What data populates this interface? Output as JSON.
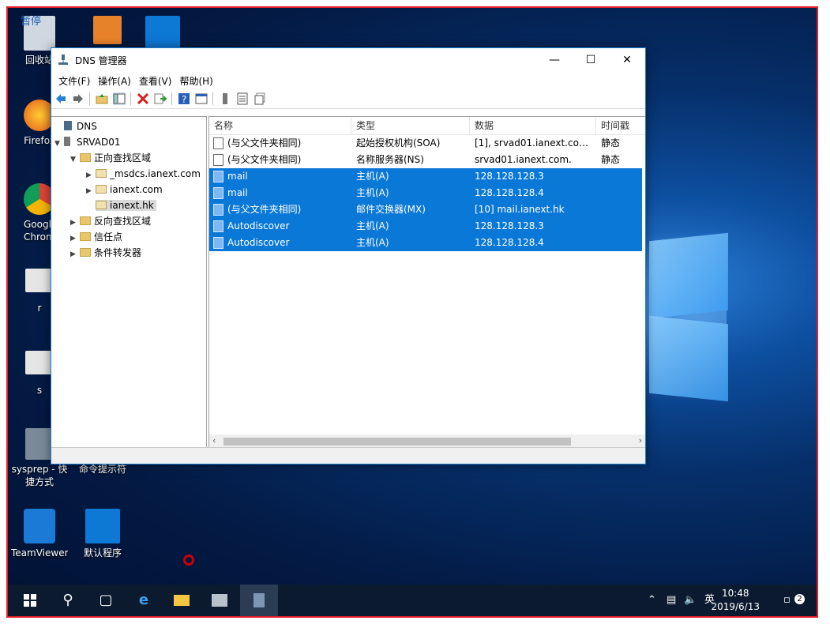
{
  "desktop": {
    "icons": [
      {
        "label": "回收站",
        "name": "recycle-bin"
      },
      {
        "label": "Firefox",
        "name": "firefox"
      },
      {
        "label": "Google Chrome",
        "name": "chrome"
      },
      {
        "label": "r",
        "name": "shortcut-r"
      },
      {
        "label": "s",
        "name": "shortcut-s"
      },
      {
        "label": "sysprep - 快捷方式",
        "name": "sysprep"
      },
      {
        "label": "命令提示符",
        "name": "cmd"
      },
      {
        "label": "TeamViewer",
        "name": "teamviewer"
      },
      {
        "label": "默认程序",
        "name": "default-programs"
      }
    ],
    "overlay_text": "暂停"
  },
  "window": {
    "title": "DNS 管理器",
    "menu": [
      "文件(F)",
      "操作(A)",
      "查看(V)",
      "帮助(H)"
    ],
    "tree": {
      "root": "DNS",
      "server": "SRVAD01",
      "forward": "正向查找区域",
      "zones": [
        "_msdcs.ianext.com",
        "ianext.com",
        "ianext.hk"
      ],
      "reverse": "反向查找区域",
      "trust": "信任点",
      "forwarders": "条件转发器"
    },
    "columns": [
      "名称",
      "类型",
      "数据",
      "时间戳"
    ],
    "records": [
      {
        "name": "(与父文件夹相同)",
        "type": "起始授权机构(SOA)",
        "data": "[1], srvad01.ianext.com.,...",
        "ts": "静态",
        "selected": false
      },
      {
        "name": "(与父文件夹相同)",
        "type": "名称服务器(NS)",
        "data": "srvad01.ianext.com.",
        "ts": "静态",
        "selected": false
      },
      {
        "name": "mail",
        "type": "主机(A)",
        "data": "128.128.128.3",
        "ts": "",
        "selected": true
      },
      {
        "name": "mail",
        "type": "主机(A)",
        "data": "128.128.128.4",
        "ts": "",
        "selected": true
      },
      {
        "name": "(与父文件夹相同)",
        "type": "邮件交换器(MX)",
        "data": "[10]  mail.ianext.hk",
        "ts": "",
        "selected": true
      },
      {
        "name": "Autodiscover",
        "type": "主机(A)",
        "data": "128.128.128.3",
        "ts": "",
        "selected": true
      },
      {
        "name": "Autodiscover",
        "type": "主机(A)",
        "data": "128.128.128.4",
        "ts": "",
        "selected": true
      }
    ]
  },
  "taskbar": {
    "ime": "英",
    "time": "10:48",
    "date": "2019/6/13",
    "notification_count": "2"
  },
  "colors": {
    "selection": "#0a78d7",
    "frame": "#e41e26",
    "taskbar": "#0b1a2f"
  }
}
